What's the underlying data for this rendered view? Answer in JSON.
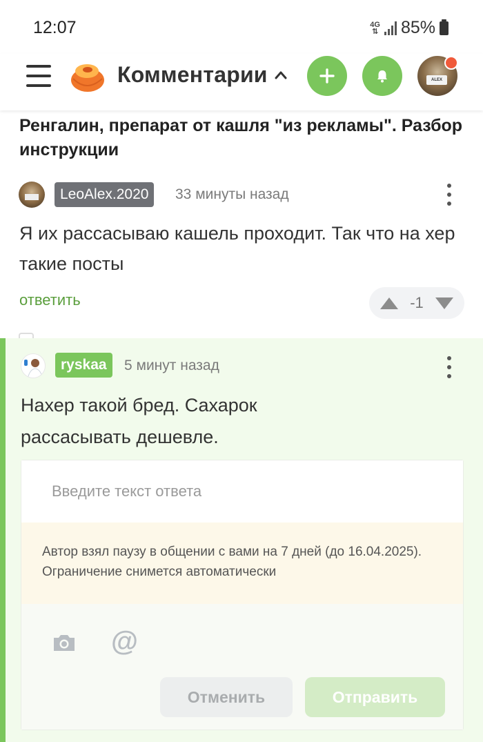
{
  "status_bar": {
    "time": "12:07",
    "network": "4G",
    "battery": "85%"
  },
  "header": {
    "title": "Комментарии",
    "icons": {
      "menu": "hamburger-icon",
      "logo": "pikabu-logo",
      "add": "plus-icon",
      "notifications": "bell-icon",
      "avatar": "user-avatar"
    },
    "accent_color": "#7bc65c",
    "notification_dot_color": "#f05a3a"
  },
  "post": {
    "title": "Ренгалин, препарат от кашля \"из рекламы\". Разбор инструкции"
  },
  "comments": [
    {
      "user": "LeoAlex.2020",
      "time": "33 минуты назад",
      "text": "Я их рассасываю кашель проходит. Так что на хер такие посты",
      "reply_label": "ответить",
      "rating": "-1"
    },
    {
      "user": "ryskaa",
      "time": "5 минут назад",
      "text": "Нахер такой бред. Сахарок рассасывать дешевле.",
      "highlight_color": "#7bc65c"
    }
  ],
  "reply_form": {
    "placeholder": "Введите текст ответа",
    "notice": "Автор взял паузу в общении с вами на 7 дней (до 16.04.2025). Ограничение снимется автоматически",
    "cancel_label": "Отменить",
    "send_label": "Отправить",
    "icons": {
      "photo": "camera-icon",
      "mention": "at-icon"
    }
  }
}
